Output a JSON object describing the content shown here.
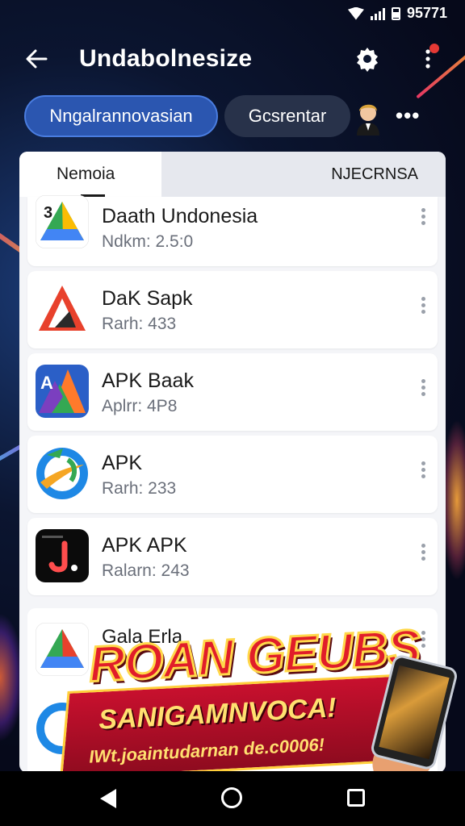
{
  "status_bar": {
    "clock": "95771"
  },
  "app_bar": {
    "title": "Undabolnesize"
  },
  "chips": {
    "primary": "Nngalrannovasian",
    "secondary": "Gcsrentar"
  },
  "tabs": [
    {
      "label": "Nemoia",
      "selected": true
    },
    {
      "label": "NJECRNSA",
      "selected": false
    }
  ],
  "apps": [
    {
      "name": "Daath Undonesia",
      "meta": "Ndkm: 2.5:0",
      "icon": "drive-triangle-icon"
    },
    {
      "name": "DaK Sapk",
      "meta": "Rarh: 433",
      "icon": "red-triangle-icon"
    },
    {
      "name": "APK Baak",
      "meta": "Aplrr: 4P8",
      "icon": "colorful-a-icon"
    },
    {
      "name": "APK",
      "meta": "Rarh: 233",
      "icon": "circle-swoosh-icon"
    },
    {
      "name": "APK APK",
      "meta": "Ralarn: 243",
      "icon": "black-j-icon"
    }
  ],
  "group2": {
    "partial_name": "Gala Erla"
  },
  "promo": {
    "title": "ROAN GEUBS",
    "subtitle": "SANIGAMNVOCA!",
    "url": "IWt.joaintudarnan de.c0006!"
  },
  "colors": {
    "accent": "#2b56b0",
    "chip_dark": "#28324a",
    "promo_red": "#e11d2a",
    "promo_yellow": "#ffd84a"
  }
}
